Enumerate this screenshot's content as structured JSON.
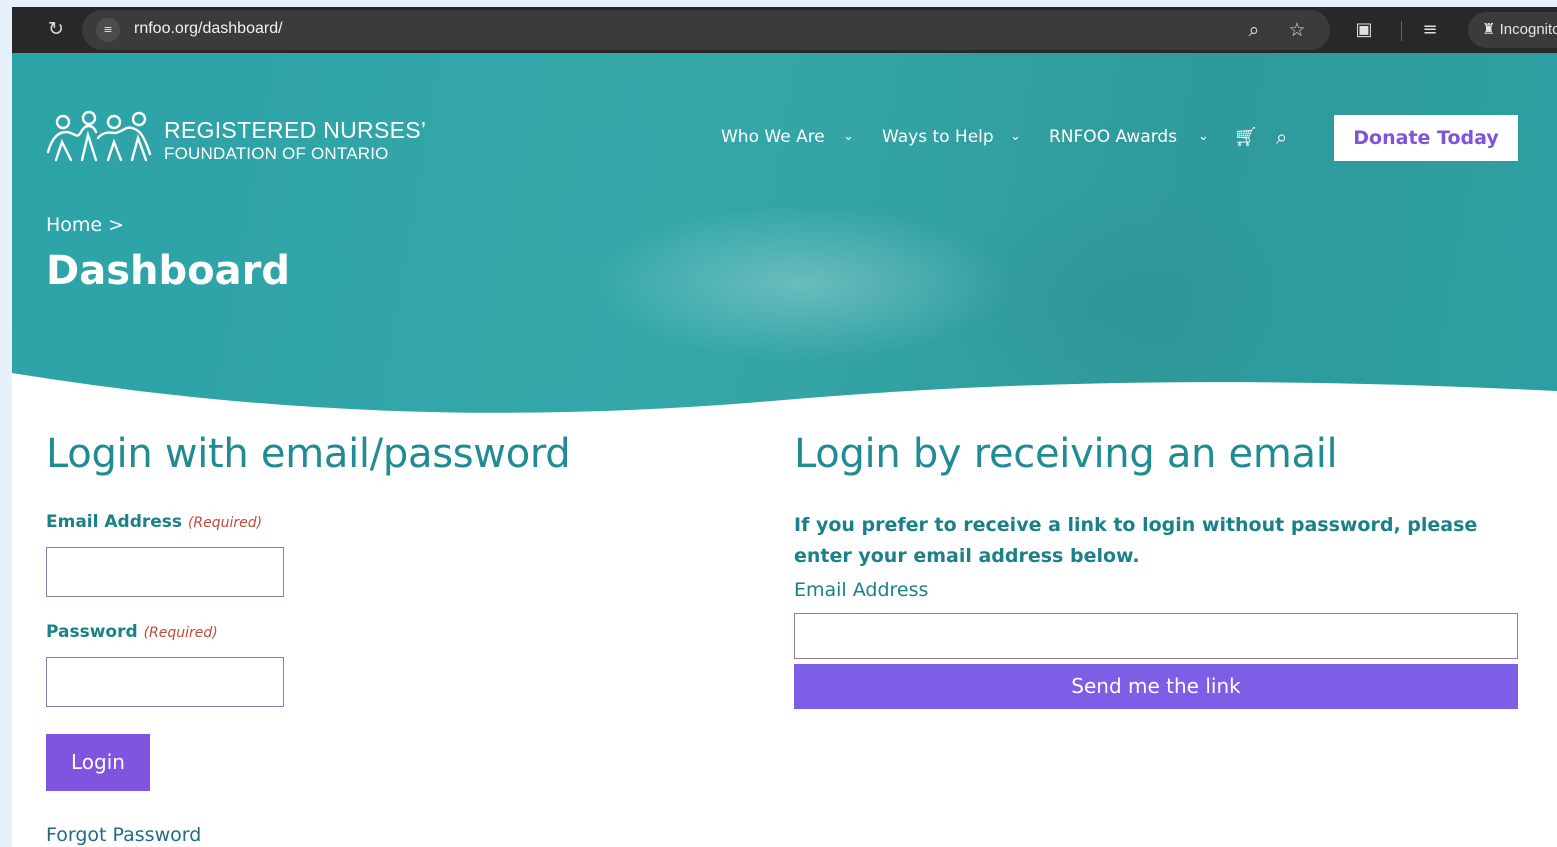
{
  "browser": {
    "url": "rnfoo.org/dashboard/",
    "incognito_label": "Incognito",
    "icons": [
      "reload-icon",
      "site-info-icon",
      "zoom-icon",
      "bookmark-star-icon",
      "screen-search-icon",
      "reading-list-icon",
      "incognito-icon"
    ]
  },
  "site": {
    "logo_line1": "REGISTERED NURSES’",
    "logo_line2": "FOUNDATION OF ONTARIO",
    "nav": [
      {
        "label": "Who We Are"
      },
      {
        "label": "Ways to Help"
      },
      {
        "label": "RNFOO Awards"
      }
    ],
    "donate_label": "Donate Today"
  },
  "hero": {
    "breadcrumb": "Home >",
    "title": "Dashboard"
  },
  "login_password": {
    "title": "Login with email/password",
    "email_label": "Email Address",
    "email_required": "(Required)",
    "email_value": "",
    "password_label": "Password",
    "password_required": "(Required)",
    "password_value": "",
    "login_button": "Login",
    "forgot_link": "Forgot Password"
  },
  "login_email": {
    "title": "Login by receiving an email",
    "note": "If you prefer to receive a link to login without password, please enter your email address below.",
    "email_label": "Email Address",
    "email_value": "",
    "send_button": "Send me the link"
  },
  "colors": {
    "teal": "#2ca3a7",
    "heading_teal": "#1f8b92",
    "purple": "#7f55df",
    "required_red": "#c14b3a"
  }
}
